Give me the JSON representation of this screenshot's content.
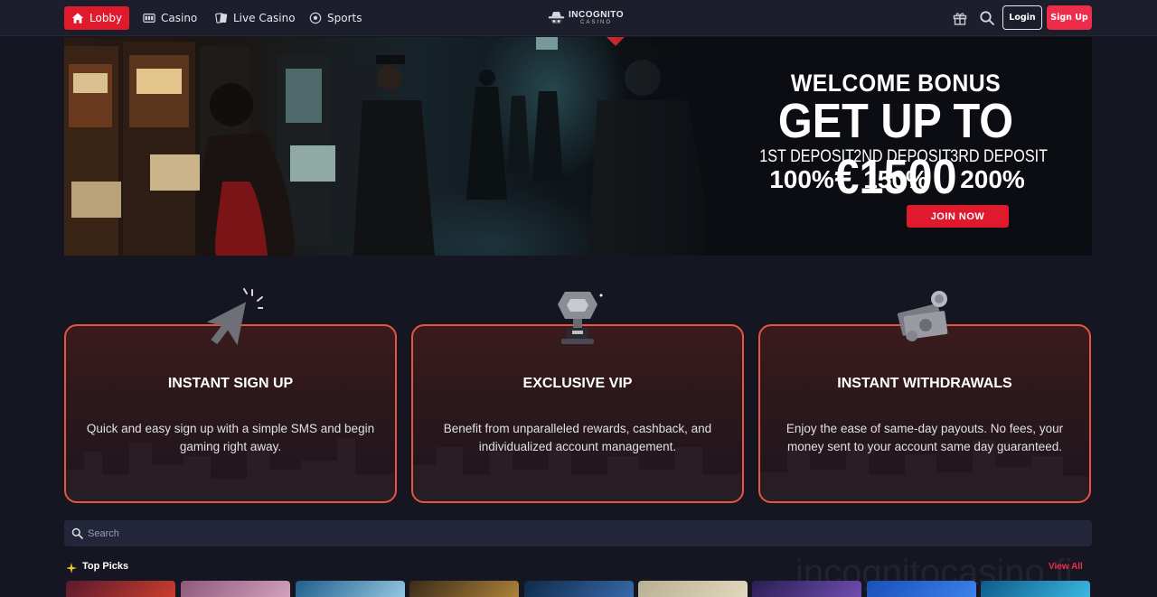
{
  "header": {
    "nav": [
      {
        "label": "Lobby",
        "icon": "home-icon",
        "active": true
      },
      {
        "label": "Casino",
        "icon": "slot-machine-icon"
      },
      {
        "label": "Live Casino",
        "icon": "cards-icon"
      },
      {
        "label": "Sports",
        "icon": "soccer-ball-icon"
      }
    ],
    "logo": {
      "main": "INCOGNITO",
      "sub": "CASINO"
    },
    "login_label": "Login",
    "signup_label": "Sign Up"
  },
  "hero": {
    "welcome": "WELCOME BONUS",
    "amount": "GET UP TO €1500",
    "deposits": [
      {
        "label": "1ST DEPOSIT",
        "percent": "100%"
      },
      {
        "label": "2ND DEPOSIT",
        "percent": "150%"
      },
      {
        "label": "3RD DEPOSIT",
        "percent": "200%"
      }
    ],
    "cta": "JOIN NOW"
  },
  "features": [
    {
      "icon": "cursor-click-icon",
      "title": "INSTANT SIGN UP",
      "desc": "Quick and easy sign up with a simple SMS and begin gaming right away."
    },
    {
      "icon": "trophy-icon",
      "title": "EXCLUSIVE VIP",
      "desc": "Benefit from unparalleled rewards, cashback, and individualized account management."
    },
    {
      "icon": "money-icon",
      "title": "INSTANT WITHDRAWALS",
      "desc": "Enjoy the ease of same-day payouts. No fees, your money sent to your account same day guaranteed."
    }
  ],
  "search": {
    "placeholder": "Search"
  },
  "top_picks": {
    "title": "Top Picks",
    "view_all": "View All",
    "watermark": "incognitocasino.fi"
  },
  "colors": {
    "accent": "#e1192c",
    "signup": "#ee2d4a",
    "card_border": "#e7543f",
    "background": "#161622"
  }
}
